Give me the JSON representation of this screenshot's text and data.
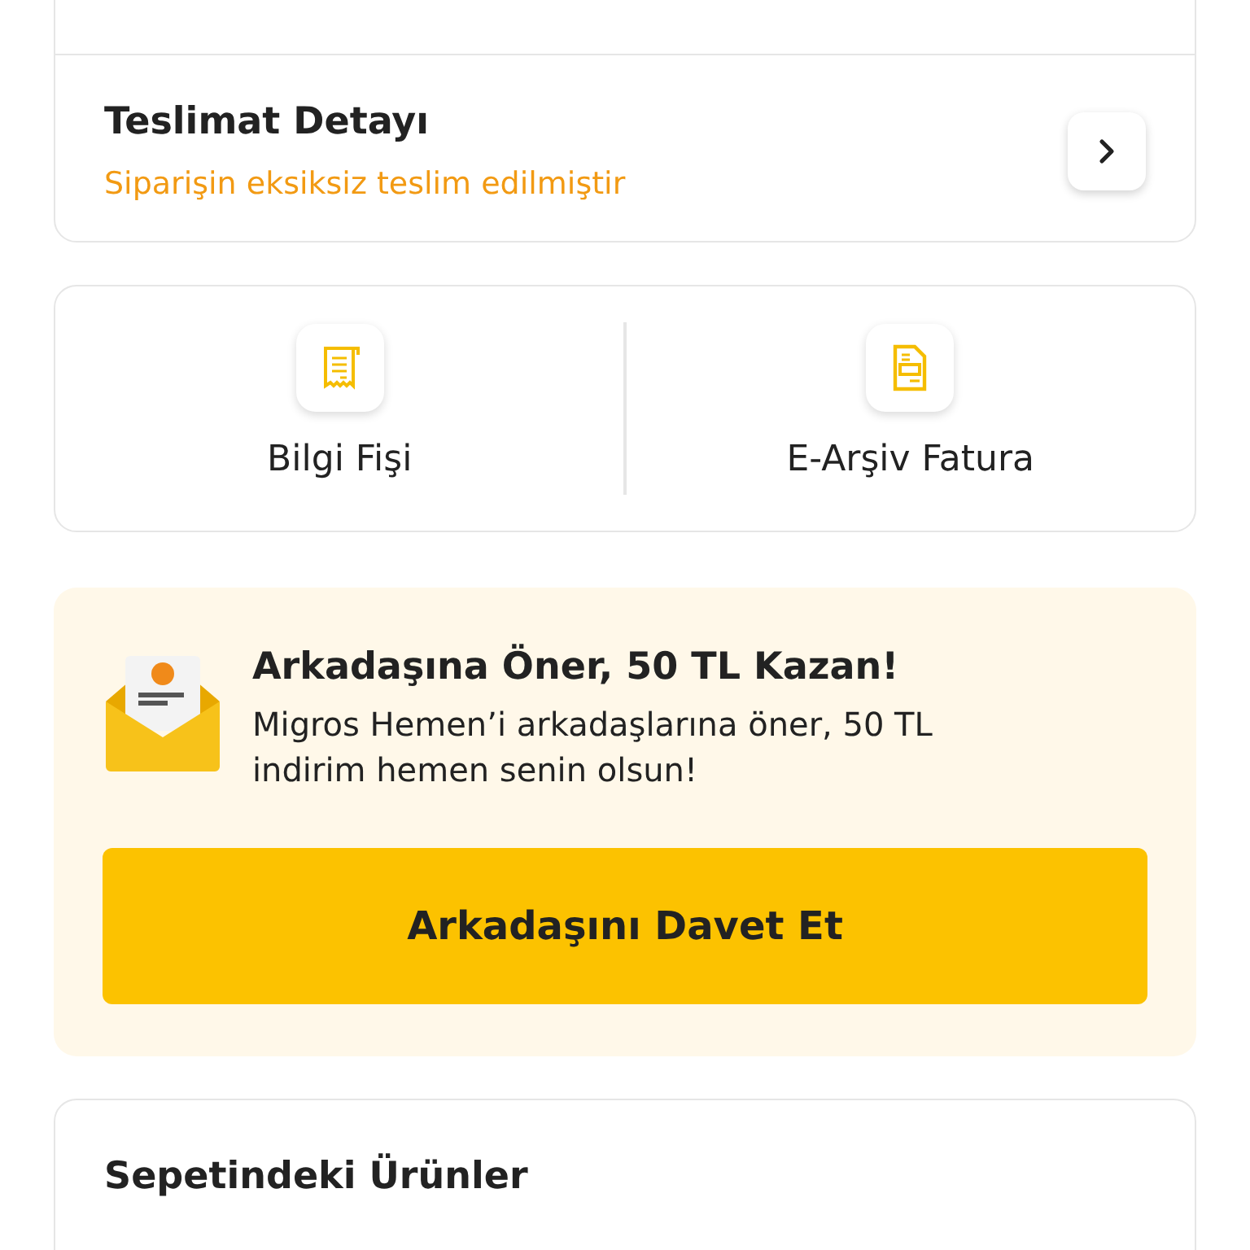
{
  "delivery": {
    "title": "Teslimat Detayı",
    "status": "Siparişin eksiksiz teslim edilmiştir"
  },
  "documents": [
    {
      "kind": "receipt",
      "label": "Bilgi Fişi"
    },
    {
      "kind": "invoice",
      "label": "E-Arşiv Fatura"
    }
  ],
  "referral": {
    "title": "Arkadaşına Öner, 50 TL Kazan!",
    "text": "Migros Hemen’i arkadaşlarına öner, 50 TL indirim hemen senin olsun!",
    "button": "Arkadaşını Davet Et"
  },
  "basket": {
    "title": "Sepetindeki Ürünler"
  }
}
